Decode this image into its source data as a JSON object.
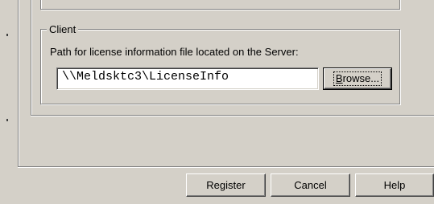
{
  "client_group": {
    "legend": "Client",
    "path_label": "Path for license information file located on the Server:",
    "path_value": "\\\\Meldsktc3\\LicenseInfo",
    "browse_label_mnemonic": "B",
    "browse_label_rest": "rowse..."
  },
  "footer": {
    "register_label": "Register",
    "cancel_label": "Cancel",
    "help_label": "Help"
  }
}
